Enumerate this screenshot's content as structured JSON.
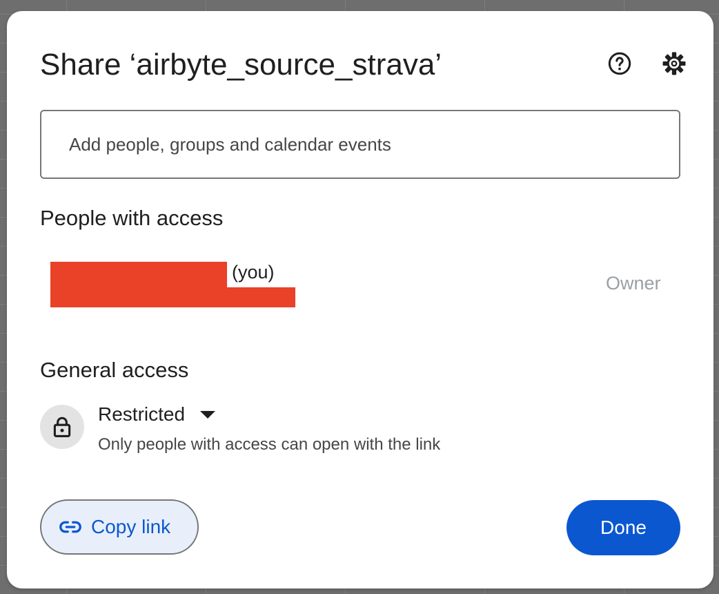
{
  "dialog": {
    "title": "Share ‘airbyte_source_strava’",
    "help_icon": "help-circle-icon",
    "settings_icon": "gear-icon"
  },
  "search": {
    "placeholder": "Add people, groups and calendar events",
    "value": ""
  },
  "people_with_access": {
    "heading": "People with access",
    "people": [
      {
        "suffix": "(you)",
        "role": "Owner"
      }
    ]
  },
  "general_access": {
    "heading": "General access",
    "icon": "lock-icon",
    "level": "Restricted",
    "description": "Only people with access can open with the link"
  },
  "footer": {
    "copy_link_icon": "link-icon",
    "copy_link_label": "Copy link",
    "done_label": "Done"
  },
  "colors": {
    "accent": "#0b57d0",
    "copy_link_bg": "#e8effa",
    "redaction": "#ea4129",
    "owner_text": "#9aa0a6",
    "backdrop": "#6e6e6e"
  }
}
